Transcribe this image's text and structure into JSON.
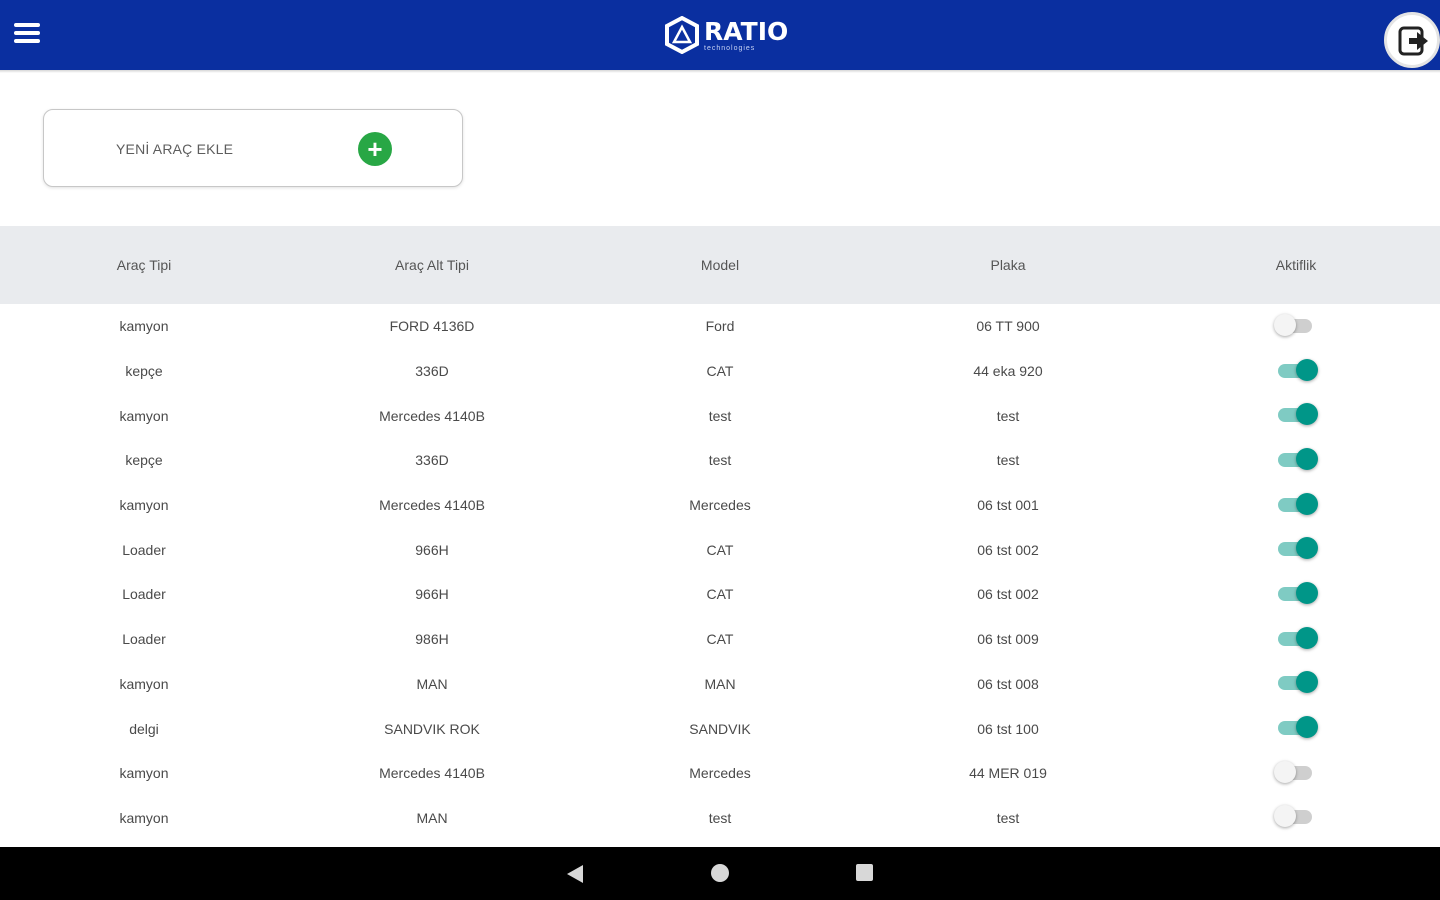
{
  "header": {
    "logo_text": "RATIO",
    "logo_subtext": "technologies",
    "brand_color": "#0a2fa0",
    "menu_icon": "hamburger-menu-icon",
    "logout_icon": "logout-icon"
  },
  "add_vehicle": {
    "label": "YENİ ARAÇ EKLE",
    "icon": "plus-icon",
    "icon_color": "#28a745"
  },
  "table": {
    "columns": [
      "Araç Tipi",
      "Araç Alt Tipi",
      "Model",
      "Plaka",
      "Aktiflik"
    ],
    "toggle_on_color": "#009688",
    "rows": [
      {
        "type": "kamyon",
        "subtype": "FORD 4136D",
        "model": "Ford",
        "plate": "06 TT 900",
        "active": false
      },
      {
        "type": "kepçe",
        "subtype": "336D",
        "model": "CAT",
        "plate": "44 eka 920",
        "active": true
      },
      {
        "type": "kamyon",
        "subtype": "Mercedes 4140B",
        "model": "test",
        "plate": "test",
        "active": true
      },
      {
        "type": "kepçe",
        "subtype": "336D",
        "model": "test",
        "plate": "test",
        "active": true
      },
      {
        "type": "kamyon",
        "subtype": "Mercedes 4140B",
        "model": "Mercedes",
        "plate": "06 tst 001",
        "active": true
      },
      {
        "type": "Loader",
        "subtype": "966H",
        "model": "CAT",
        "plate": "06 tst 002",
        "active": true
      },
      {
        "type": "Loader",
        "subtype": "966H",
        "model": "CAT",
        "plate": "06 tst 002",
        "active": true
      },
      {
        "type": "Loader",
        "subtype": "986H",
        "model": "CAT",
        "plate": "06 tst 009",
        "active": true
      },
      {
        "type": "kamyon",
        "subtype": "MAN",
        "model": "MAN",
        "plate": "06 tst 008",
        "active": true
      },
      {
        "type": "delgi",
        "subtype": "SANDVIK ROK",
        "model": "SANDVIK",
        "plate": "06 tst 100",
        "active": true
      },
      {
        "type": "kamyon",
        "subtype": "Mercedes 4140B",
        "model": "Mercedes",
        "plate": "44 MER 019",
        "active": false
      },
      {
        "type": "kamyon",
        "subtype": "MAN",
        "model": "test",
        "plate": "test",
        "active": false
      }
    ]
  },
  "system_nav": {
    "back_icon": "back-triangle-icon",
    "home_icon": "home-circle-icon",
    "recent_icon": "recent-apps-square-icon"
  }
}
